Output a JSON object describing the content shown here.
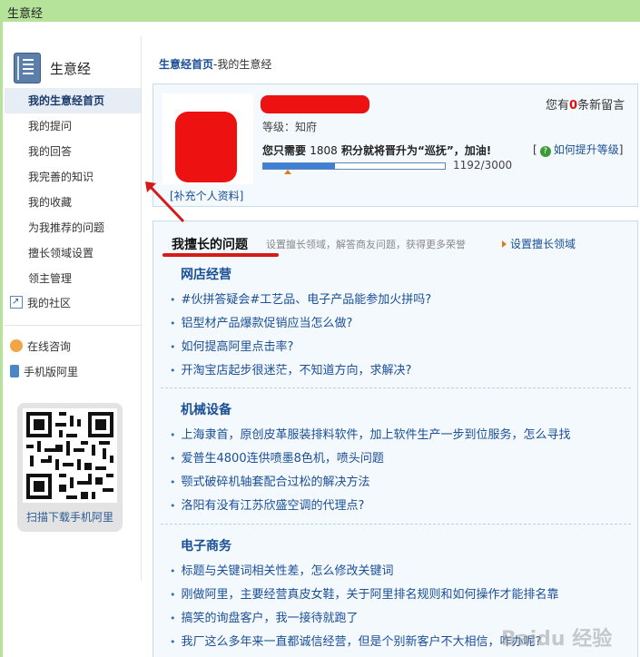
{
  "window": {
    "title": "生意经"
  },
  "sidebar": {
    "title": "生意经",
    "items": [
      {
        "label": "我的生意经首页",
        "active": true
      },
      {
        "label": "我的提问"
      },
      {
        "label": "我的回答"
      },
      {
        "label": "我完善的知识"
      },
      {
        "label": "我的收藏"
      },
      {
        "label": "为我推荐的问题"
      },
      {
        "label": "擅长领域设置"
      },
      {
        "label": "领主管理"
      }
    ],
    "community": "我的社区",
    "online_consult": "在线咨询",
    "mobile": "手机版阿里",
    "qr_caption": "扫描下载手机阿里"
  },
  "breadcrumb": {
    "home": "生意经首页",
    "current": "-我的生意经"
  },
  "profile": {
    "messages_prefix": "您有",
    "messages_count": "0",
    "messages_suffix": "条新留言",
    "level": "等级：知府",
    "upgrade_prefix": "您只需要",
    "upgrade_points": "1808",
    "upgrade_suffix": "积分就将晋升为“巡抚”，加油!",
    "howto_open": "[",
    "howto_label": "如何提升等级",
    "howto_close": "]",
    "progress_text": "1192/3000",
    "progress_value": 0.3973,
    "supplement": "[补充个人资料]"
  },
  "expertise": {
    "title": "我擅长的问题",
    "description": "设置擅长领域，解答商友问题，获得更多荣誉",
    "set_link": "设置擅长领域",
    "categories": [
      {
        "name": "网店经营",
        "questions": [
          "#伙拼答疑会#工艺品、电子产品能参加火拼吗?",
          "铝型材产品爆款促销应当怎么做?",
          "如何提高阿里点击率?",
          "开淘宝店起步很迷茫，不知道方向，求解决?"
        ]
      },
      {
        "name": "机械设备",
        "questions": [
          "上海隶首，原创皮革服装排料软件，加上软件生产一步到位服务，怎么寻找",
          "爱普生4800连供喷墨8色机，喷头问题",
          "颚式破碎机轴套配合过松的解决方法",
          "洛阳有没有江苏欣盛空调的代理点?"
        ]
      },
      {
        "name": "电子商务",
        "questions": [
          "标题与关键词相关性差，怎么修改关键词",
          "刚做阿里，主要经营真皮女鞋，关于阿里排名规则和如何操作才能排名靠",
          "搞笑的询盘客户，我一接待就跑了",
          "我厂这么多年来一直都诚信经营，但是个别新客户不大相信，咋办呢?"
        ]
      }
    ]
  },
  "watermark": "Baidu 经验",
  "colors": {
    "accent": "#1a4f96",
    "titlebar": "#b6e39a",
    "redaction": "#ee1111"
  }
}
